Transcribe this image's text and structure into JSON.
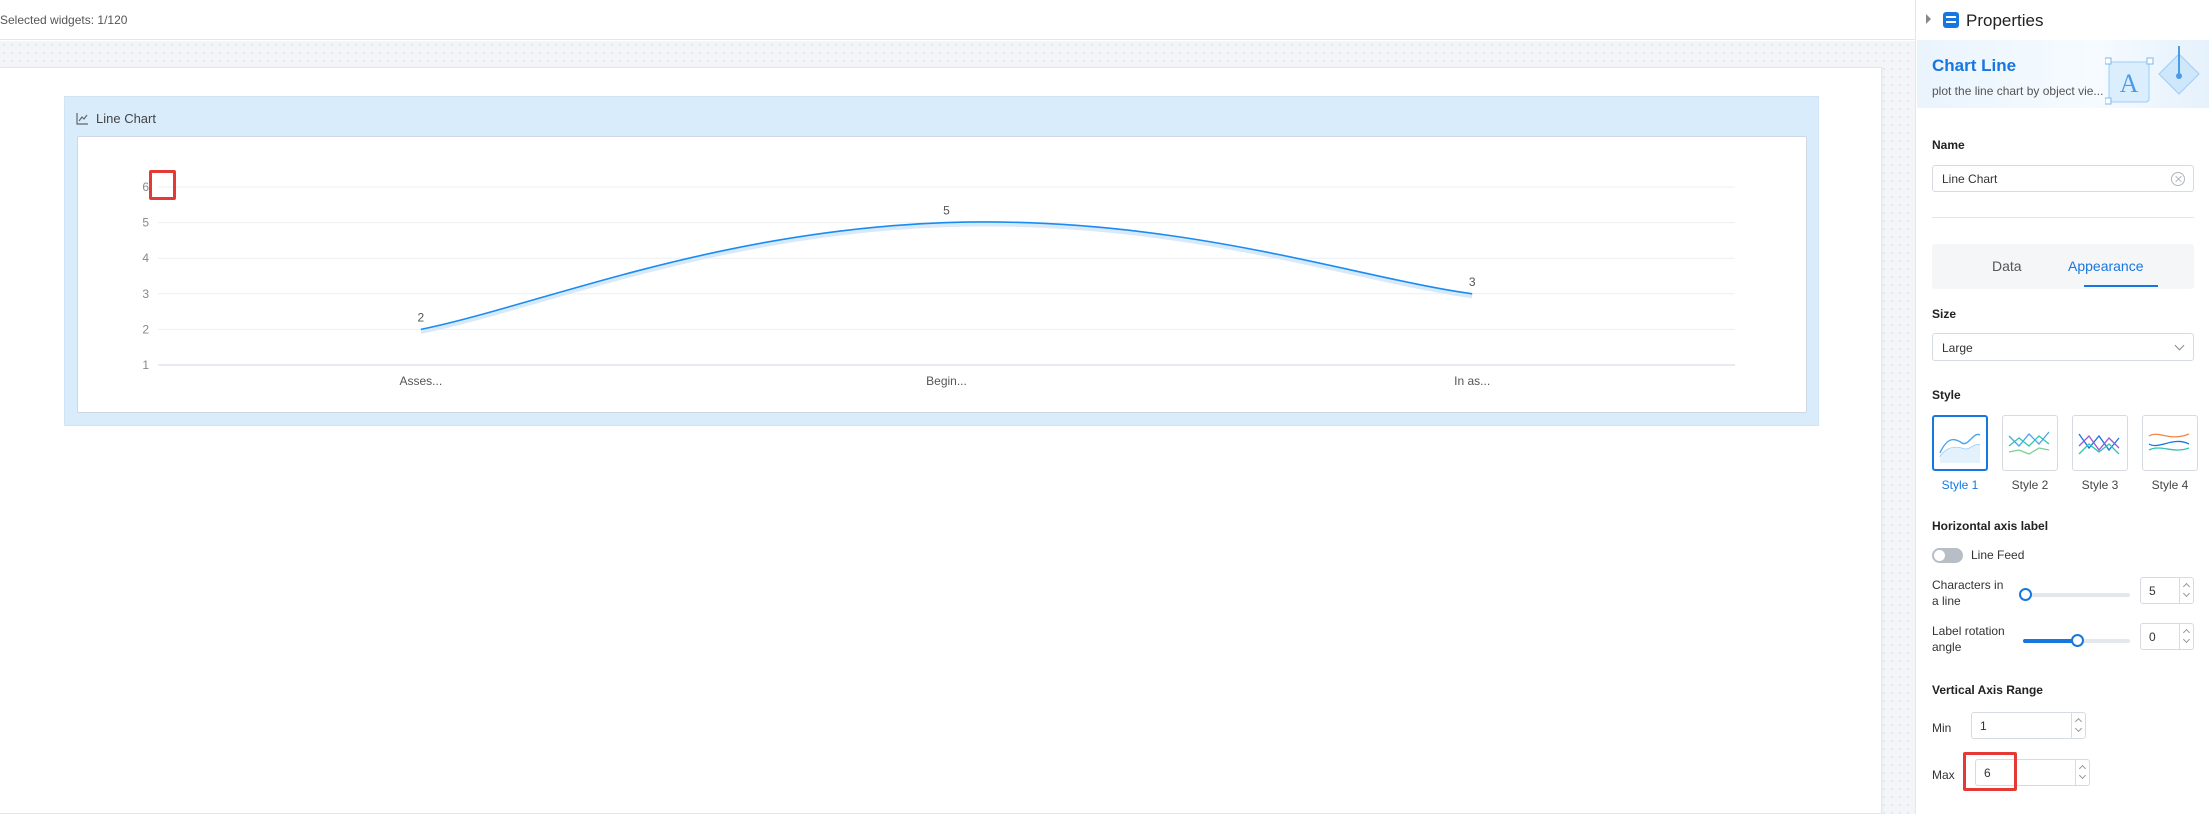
{
  "topbar": {
    "selected_text": "Selected widgets: 1/120"
  },
  "widget": {
    "title": "Line Chart",
    "icon": "line-chart-icon"
  },
  "chart_data": {
    "type": "line",
    "categories": [
      "Asses...",
      "Begin...",
      "In as..."
    ],
    "series": [
      {
        "values": [
          2,
          5,
          3
        ],
        "color": "#1a8cf0"
      }
    ],
    "y_ticks": [
      1,
      2,
      3,
      4,
      5,
      6
    ],
    "ylim": [
      1,
      6
    ],
    "smooth": true,
    "data_labels": true,
    "grid": true
  },
  "panel": {
    "header_title": "Properties",
    "banner_title": "Chart Line",
    "banner_subtitle": "plot the line chart by object vie...",
    "name_label": "Name",
    "name_value": "Line Chart",
    "tabs": [
      {
        "label": "Data",
        "active": false
      },
      {
        "label": "Appearance",
        "active": true
      }
    ],
    "size_label": "Size",
    "size_value": "Large",
    "style_label": "Style",
    "styles": [
      {
        "label": "Style 1",
        "active": true
      },
      {
        "label": "Style 2",
        "active": false
      },
      {
        "label": "Style 3",
        "active": false
      },
      {
        "label": "Style 4",
        "active": false
      }
    ],
    "haxis_label": "Horizontal axis label",
    "line_feed_label": "Line Feed",
    "line_feed_on": false,
    "chars_label": "Characters in a line",
    "chars_value": "5",
    "chars_slider_fraction": 0.02,
    "rotation_label": "Label rotation angle",
    "rotation_value": "0",
    "rotation_slider_fraction": 0.5,
    "vrange_label": "Vertical Axis Range",
    "min_label": "Min",
    "min_value": "1",
    "max_label": "Max",
    "max_value": "6"
  },
  "colors": {
    "accent": "#1677e0",
    "highlight": "#e53935",
    "line": "#1a8cf0"
  }
}
